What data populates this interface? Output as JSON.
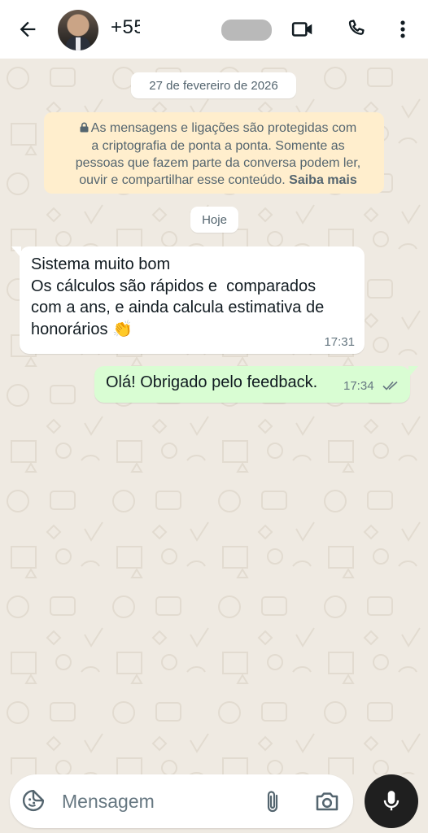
{
  "header": {
    "back_icon": "arrow-left-icon",
    "contact_name": "+55",
    "video_icon": "video-camera-icon",
    "call_icon": "phone-icon",
    "more_icon": "more-vertical-icon"
  },
  "chat": {
    "date_label": "27 de fevereiro de 2026",
    "encryption_notice": {
      "lines": [
        "As mensagens e ligações são protegidas com",
        "a criptografia de ponta a ponta. Somente as",
        "pessoas que fazem parte da conversa podem ler,",
        "ouvir e compartilhar esse conteúdo."
      ],
      "link": "Saiba mais",
      "icon": "lock-icon"
    },
    "today_label": "Hoje",
    "messages": [
      {
        "direction": "incoming",
        "lines": [
          "Sistema muito bom",
          "Os cálculos são rápidos e  comparados",
          "com a ans, e ainda calcula estimativa de",
          "honorários"
        ],
        "emoji": "👏",
        "time": "17:31"
      },
      {
        "direction": "outgoing",
        "text": "Olá! Obrigado pelo feedback.",
        "time": "17:34",
        "status_icon": "double-check-icon"
      }
    ]
  },
  "composer": {
    "placeholder": "Mensagem",
    "emoji_icon": "sticker-icon",
    "attach_icon": "paperclip-icon",
    "camera_icon": "camera-icon",
    "mic_icon": "microphone-icon"
  },
  "colors": {
    "background": "#efeae2",
    "incoming_bubble": "#ffffff",
    "outgoing_bubble": "#d9fdd3",
    "notice_bg": "#ffeecd",
    "read_ticks": "#667781"
  }
}
